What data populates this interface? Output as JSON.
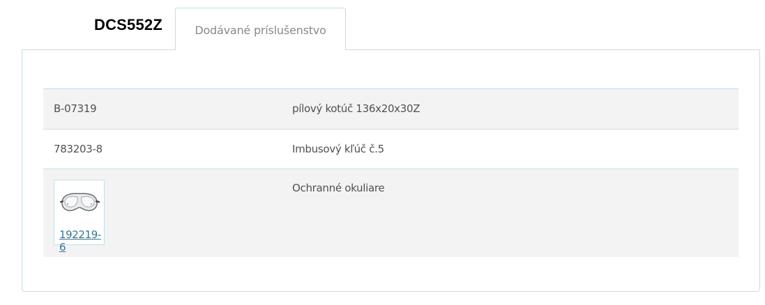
{
  "product": {
    "model": "DCS552Z"
  },
  "tabs": [
    {
      "label": "Dodávané príslušenstvo",
      "active": true
    }
  ],
  "accessories": {
    "rows": [
      {
        "code": "B-07319",
        "description": "pílový kotúč 136x20x30Z",
        "has_image": false
      },
      {
        "code": "783203-8",
        "description": "Imbusový kľúč č.5",
        "has_image": false
      },
      {
        "code": "192219-6",
        "description": "Ochranné okuliare",
        "has_image": true,
        "image_icon": "safety-goggles-icon"
      }
    ]
  },
  "colors": {
    "border": "#c5dde5",
    "row_shade": "#f3f3f3",
    "link": "#2f7a93",
    "tab_text": "#8a8a8a",
    "title_text": "#000000"
  }
}
